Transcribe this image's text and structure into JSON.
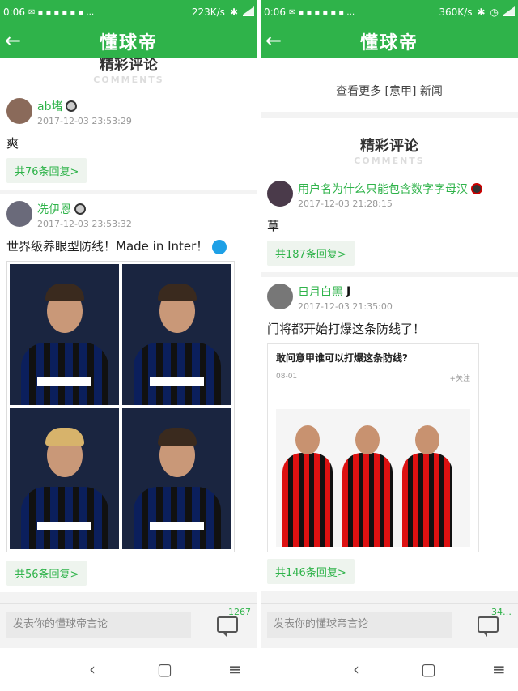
{
  "left": {
    "status": {
      "time": "0:06",
      "speed": "223K/s"
    },
    "app_title": "懂球帝",
    "section": {
      "title": "精彩评论",
      "subtitle": "COMMENTS"
    },
    "comments": [
      {
        "name": "ab堵",
        "time": "2017-12-03 23:53:29",
        "text": "爽",
        "replies": "共76条回复>"
      },
      {
        "name": "冼伊恩",
        "time": "2017-12-03 23:53:32",
        "text": "世界级养眼型防线！Made in Inter！",
        "replies": "共56条回复>"
      }
    ],
    "input_placeholder": "发表你的懂球帝言论",
    "comment_count": "1267"
  },
  "right": {
    "status": {
      "time": "0:06",
      "speed": "360K/s"
    },
    "app_title": "懂球帝",
    "news_more": "查看更多 [意甲] 新闻",
    "section": {
      "title": "精彩评论",
      "subtitle": "COMMENTS"
    },
    "comments": [
      {
        "name": "用户名为什么只能包含数字字母汉",
        "time": "2017-12-03 21:28:15",
        "text": "草",
        "replies": "共187条回复>"
      },
      {
        "name": "日月白黑",
        "time": "2017-12-03 21:35:00",
        "text": "门将都开始打爆这条防线了！",
        "replies": "共146条回复>"
      }
    ],
    "ad_card": {
      "title": "敢问意甲谁可以打爆这条防线?",
      "meta_left": "08-01",
      "meta_right": "+关注"
    },
    "input_placeholder": "发表你的懂球帝言论",
    "comment_count": "34…"
  },
  "nav": {
    "back": "‹",
    "home": "▢",
    "menu": "≡"
  },
  "colors": {
    "accent": "#2fb34a"
  }
}
